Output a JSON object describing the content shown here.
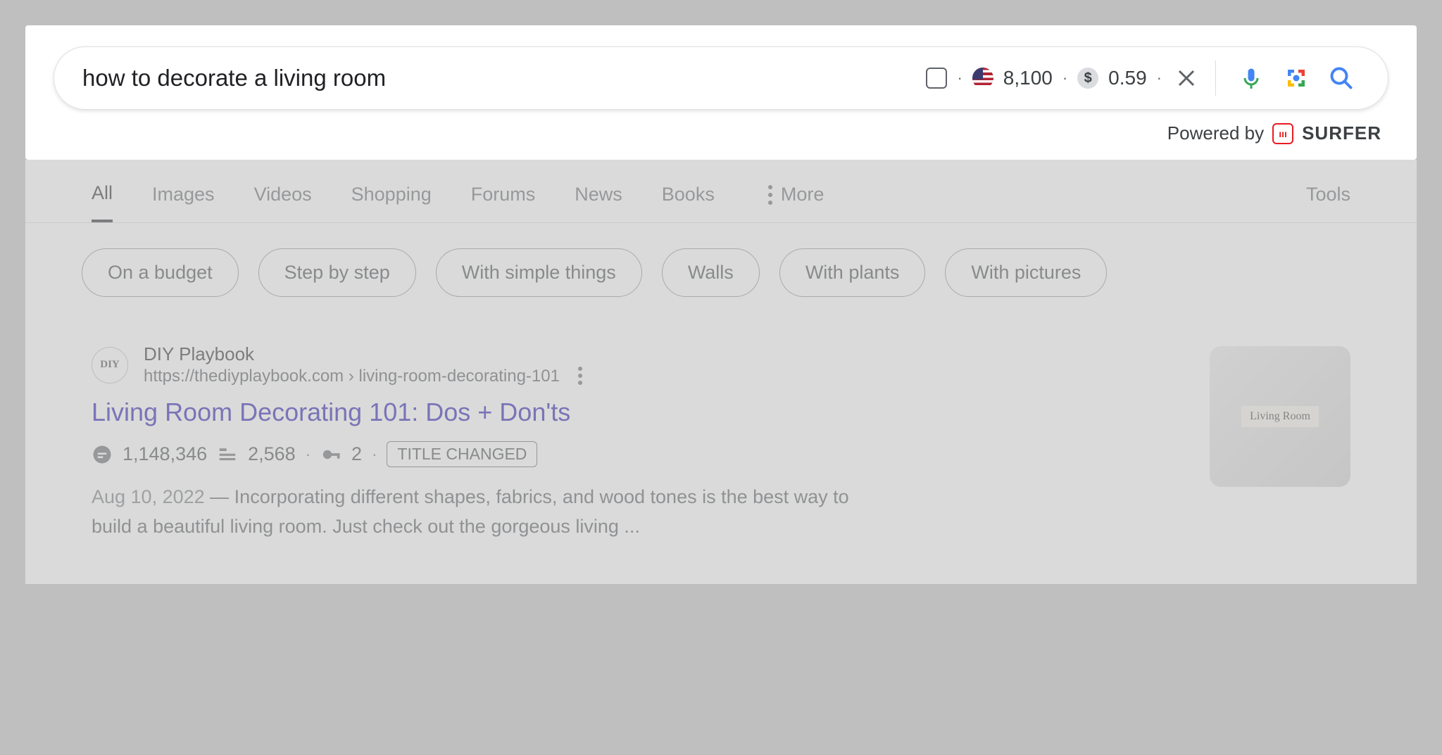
{
  "search": {
    "query": "how to decorate a living room",
    "volume": "8,100",
    "cpc": "0.59",
    "dollar_symbol": "$"
  },
  "powered_by": {
    "prefix": "Powered by",
    "brand": "SURFER"
  },
  "tabs": {
    "items": [
      "All",
      "Images",
      "Videos",
      "Shopping",
      "Forums",
      "News",
      "Books"
    ],
    "more": "More",
    "tools": "Tools",
    "active_index": 0
  },
  "chips": [
    "On a budget",
    "Step by step",
    "With simple things",
    "Walls",
    "With plants",
    "With pictures"
  ],
  "result": {
    "favicon_text": "DIY",
    "site_name": "DIY Playbook",
    "url_display": "https://thediyplaybook.com › living-room-decorating-101",
    "title": "Living Room Decorating 101: Dos + Don'ts",
    "stats": {
      "traffic": "1,148,346",
      "words": "2,568",
      "keywords": "2"
    },
    "badge": "TITLE CHANGED",
    "date": "Aug 10, 2022",
    "snippet_sep": " — ",
    "snippet": "Incorporating different shapes, fabrics, and wood tones is the best way to build a beautiful living room. Just check out the gorgeous living ...",
    "thumb_label": "Living Room"
  }
}
